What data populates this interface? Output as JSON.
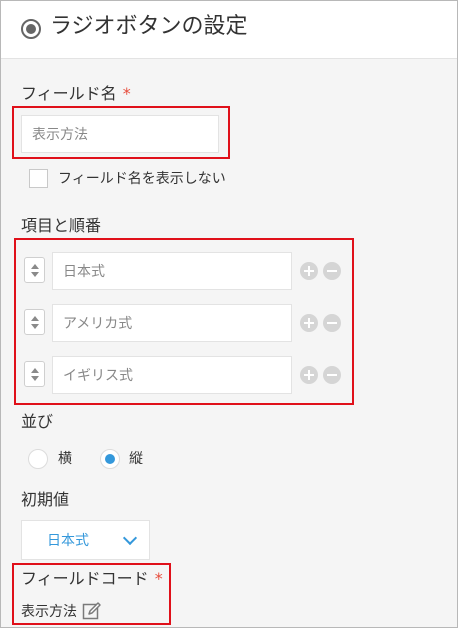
{
  "header": {
    "title": "ラジオボタンの設定"
  },
  "field_name": {
    "label": "フィールド名",
    "required_mark": "*",
    "value": "表示方法",
    "hide_label": "フィールド名を表示しない"
  },
  "items": {
    "label": "項目と順番",
    "options": [
      "日本式",
      "アメリカ式",
      "イギリス式"
    ]
  },
  "alignment": {
    "label": "並び",
    "options": [
      {
        "label": "横",
        "checked": false
      },
      {
        "label": "縦",
        "checked": true
      }
    ]
  },
  "initial": {
    "label": "初期値",
    "value": "日本式"
  },
  "field_code": {
    "label": "フィールドコード",
    "required_mark": "*",
    "value": "表示方法"
  },
  "colors": {
    "accent": "#3498db",
    "required": "#e74c3c",
    "highlight": "#e0101a"
  },
  "icons": {
    "header": "radio-icon",
    "sort": "sort-handle-icon",
    "add": "plus-circle-icon",
    "remove": "minus-circle-icon",
    "dropdown": "chevron-down-icon",
    "edit": "pencil-icon"
  }
}
